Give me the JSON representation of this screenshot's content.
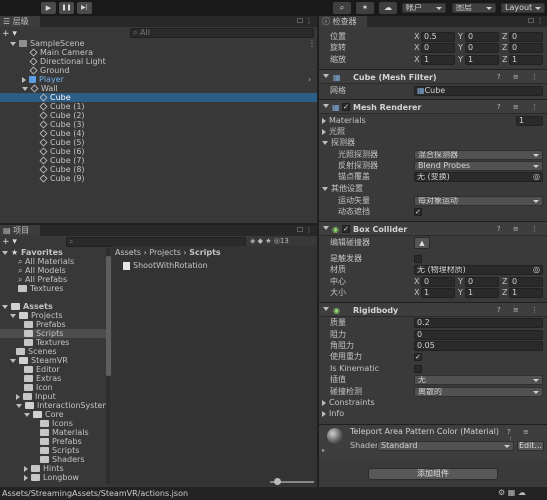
{
  "toolbar": {
    "play_icon": "▶",
    "pause_icon": "❚❚",
    "step_icon": "▶|",
    "account": "帐户",
    "layers": "图层",
    "layout": "Layout"
  },
  "hierarchy": {
    "tab": "层级",
    "search_placeholder": "All",
    "scene": "SampleScene",
    "items": [
      "Main Camera",
      "Directional Light",
      "Ground",
      "Player",
      "Wall"
    ],
    "cubes": [
      "Cube",
      "Cube (1)",
      "Cube (2)",
      "Cube (3)",
      "Cube (4)",
      "Cube (5)",
      "Cube (6)",
      "Cube (7)",
      "Cube (8)",
      "Cube (9)"
    ]
  },
  "project": {
    "tab": "项目",
    "favorites": {
      "label": "Favorites",
      "items": [
        "All Materials",
        "All Models",
        "All Prefabs",
        "Textures"
      ]
    },
    "assets": {
      "label": "Assets",
      "tree": [
        "Projects",
        "Prefabs",
        "Scripts",
        "Textures",
        "Scenes",
        "SteamVR",
        "Editor",
        "Extras",
        "Icon",
        "Input",
        "InteractionSystem",
        "Core",
        "Icons",
        "Materials",
        "Prefabs",
        "Scripts",
        "Shaders",
        "Hints",
        "Longbow"
      ]
    },
    "breadcrumb": [
      "Assets",
      "Projects",
      "Scripts"
    ],
    "file": "ShootWithRotation",
    "hidden_count": "13",
    "status": "Assets/StreamingAssets/SteamVR/actions.json"
  },
  "inspector": {
    "tab": "检查器",
    "transform": {
      "pos_label": "位置",
      "rot_label": "旋转",
      "scale_label": "缩放",
      "pos": [
        "0.5",
        "0",
        "0"
      ],
      "rot": [
        "0",
        "0",
        "0"
      ],
      "scale": [
        "1",
        "1",
        "1"
      ]
    },
    "mesh_filter": {
      "title": "Cube (Mesh Filter)",
      "mesh_label": "网格",
      "mesh_value": "Cube"
    },
    "mesh_renderer": {
      "title": "Mesh Renderer",
      "materials_label": "Materials",
      "materials_count": "1",
      "lighting": "光照",
      "probes": "探测器",
      "light_probe_label": "光照探测器",
      "light_probe_value": "混合探测器",
      "reflection_label": "反射探测器",
      "reflection_value": "Blend Probes",
      "anchor_label": "锚点覆盖",
      "anchor_value": "无 (变换)",
      "other": "其他设置",
      "motion_label": "运动矢量",
      "motion_value": "每对象运动",
      "occlusion_label": "动态遮挡"
    },
    "box_collider": {
      "title": "Box Collider",
      "edit_label": "编辑碰撞器",
      "trigger_label": "是触发器",
      "material_label": "材质",
      "material_value": "无 (物理材质)",
      "center_label": "中心",
      "size_label": "大小",
      "center": [
        "0",
        "0",
        "0"
      ],
      "size": [
        "1",
        "1",
        "1"
      ]
    },
    "rigidbody": {
      "title": "Rigidbody",
      "mass_label": "质量",
      "mass": "0.2",
      "drag_label": "阻力",
      "drag": "0",
      "angular_label": "角阻力",
      "angular": "0.05",
      "gravity_label": "使用重力",
      "kinematic_label": "Is Kinematic",
      "interp_label": "插值",
      "interp_value": "无",
      "collision_label": "碰撞检测",
      "collision_value": "离散的",
      "constraints_label": "Constraints",
      "info_label": "Info"
    },
    "material": {
      "title": "Teleport Area Pattern Color (Material)",
      "shader_label": "Shader",
      "shader_value": "Standard",
      "edit_label": "Edit..."
    },
    "add_component": "添加组件"
  }
}
